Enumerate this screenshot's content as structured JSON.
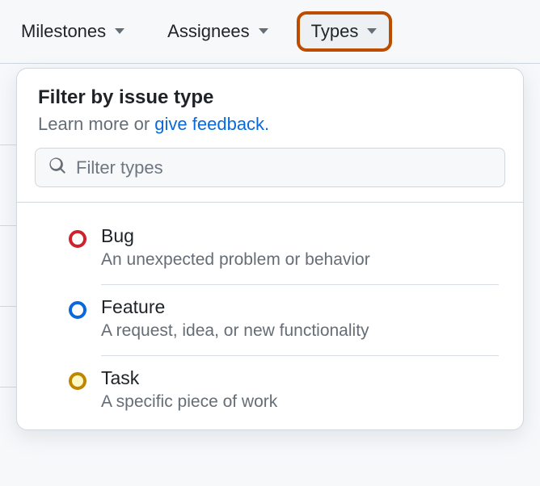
{
  "toolbar": {
    "milestones_label": "Milestones",
    "assignees_label": "Assignees",
    "types_label": "Types"
  },
  "dropdown": {
    "title": "Filter by issue type",
    "subtitle_prefix": "Learn more or ",
    "subtitle_link": "give feedback.",
    "search_placeholder": "Filter types"
  },
  "types": [
    {
      "name": "Bug",
      "desc": "An unexpected problem or behavior",
      "color": "red"
    },
    {
      "name": "Feature",
      "desc": "A request, idea, or new functionality",
      "color": "blue"
    },
    {
      "name": "Task",
      "desc": "A specific piece of work",
      "color": "yellow"
    }
  ]
}
